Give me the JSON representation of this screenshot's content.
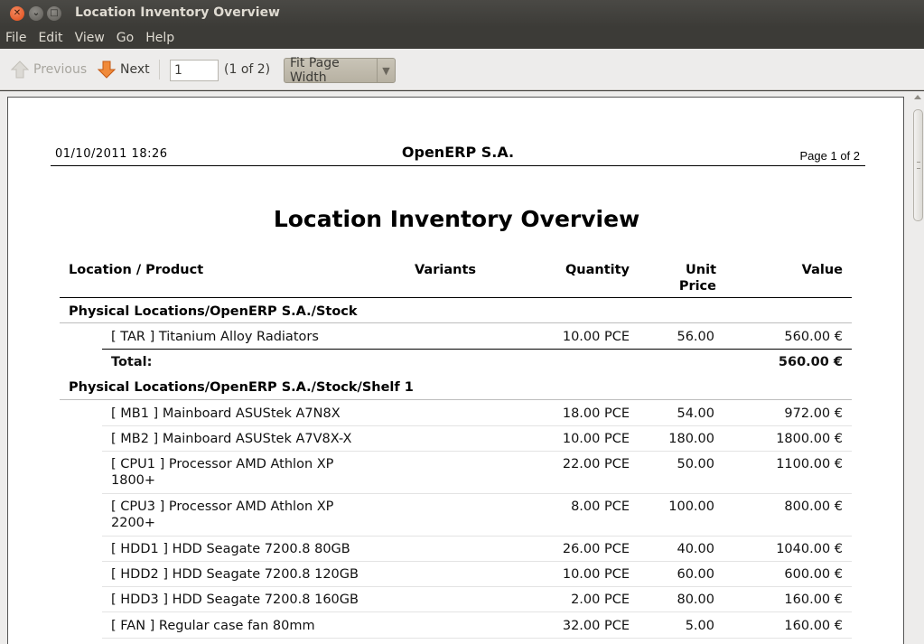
{
  "window": {
    "title": "Location Inventory Overview"
  },
  "menu": [
    "File",
    "Edit",
    "View",
    "Go",
    "Help"
  ],
  "toolbar": {
    "previous_label": "Previous",
    "next_label": "Next",
    "page_value": "1",
    "page_count": "(1 of 2)",
    "zoom_value": "Fit Page Width"
  },
  "report": {
    "date": "01/10/2011  18:26",
    "company": "OpenERP S.A.",
    "page_label": "Page 1 of 2",
    "title": "Location Inventory Overview",
    "headers": {
      "location_product": "Location / Product",
      "variants": "Variants",
      "quantity": "Quantity",
      "unit_price_line1": "Unit",
      "unit_price_line2": "Price",
      "value": "Value"
    },
    "groups": [
      {
        "name": "Physical Locations/OpenERP S.A./Stock",
        "rows": [
          {
            "product": "[ TAR ] Titanium Alloy Radiators",
            "quantity": "10.00 PCE",
            "unit_price": "56.00",
            "value": "560.00 €"
          }
        ],
        "total_label": "Total:",
        "total_value": "560.00 €"
      },
      {
        "name": "Physical Locations/OpenERP S.A./Stock/Shelf 1",
        "rows": [
          {
            "product": "[ MB1 ] Mainboard ASUStek A7N8X",
            "quantity": "18.00 PCE",
            "unit_price": "54.00",
            "value": "972.00 €"
          },
          {
            "product": "[ MB2 ] Mainboard ASUStek A7V8X-X",
            "quantity": "10.00 PCE",
            "unit_price": "180.00",
            "value": "1800.00 €"
          },
          {
            "product": "[ CPU1 ] Processor AMD Athlon XP",
            "product_line2": "1800+",
            "quantity": "22.00 PCE",
            "unit_price": "50.00",
            "value": "1100.00 €"
          },
          {
            "product": "[ CPU3 ] Processor AMD Athlon XP",
            "product_line2": "2200+",
            "quantity": "8.00 PCE",
            "unit_price": "100.00",
            "value": "800.00 €"
          },
          {
            "product": "[ HDD1 ] HDD Seagate 7200.8 80GB",
            "quantity": "26.00 PCE",
            "unit_price": "40.00",
            "value": "1040.00 €"
          },
          {
            "product": "[ HDD2 ] HDD Seagate 7200.8 120GB",
            "quantity": "10.00 PCE",
            "unit_price": "60.00",
            "value": "600.00 €"
          },
          {
            "product": "[ HDD3 ] HDD Seagate 7200.8 160GB",
            "quantity": "2.00 PCE",
            "unit_price": "80.00",
            "value": "160.00 €"
          },
          {
            "product": "[ FAN ] Regular case fan 80mm",
            "quantity": "32.00 PCE",
            "unit_price": "5.00",
            "value": "160.00 €"
          }
        ]
      }
    ]
  }
}
